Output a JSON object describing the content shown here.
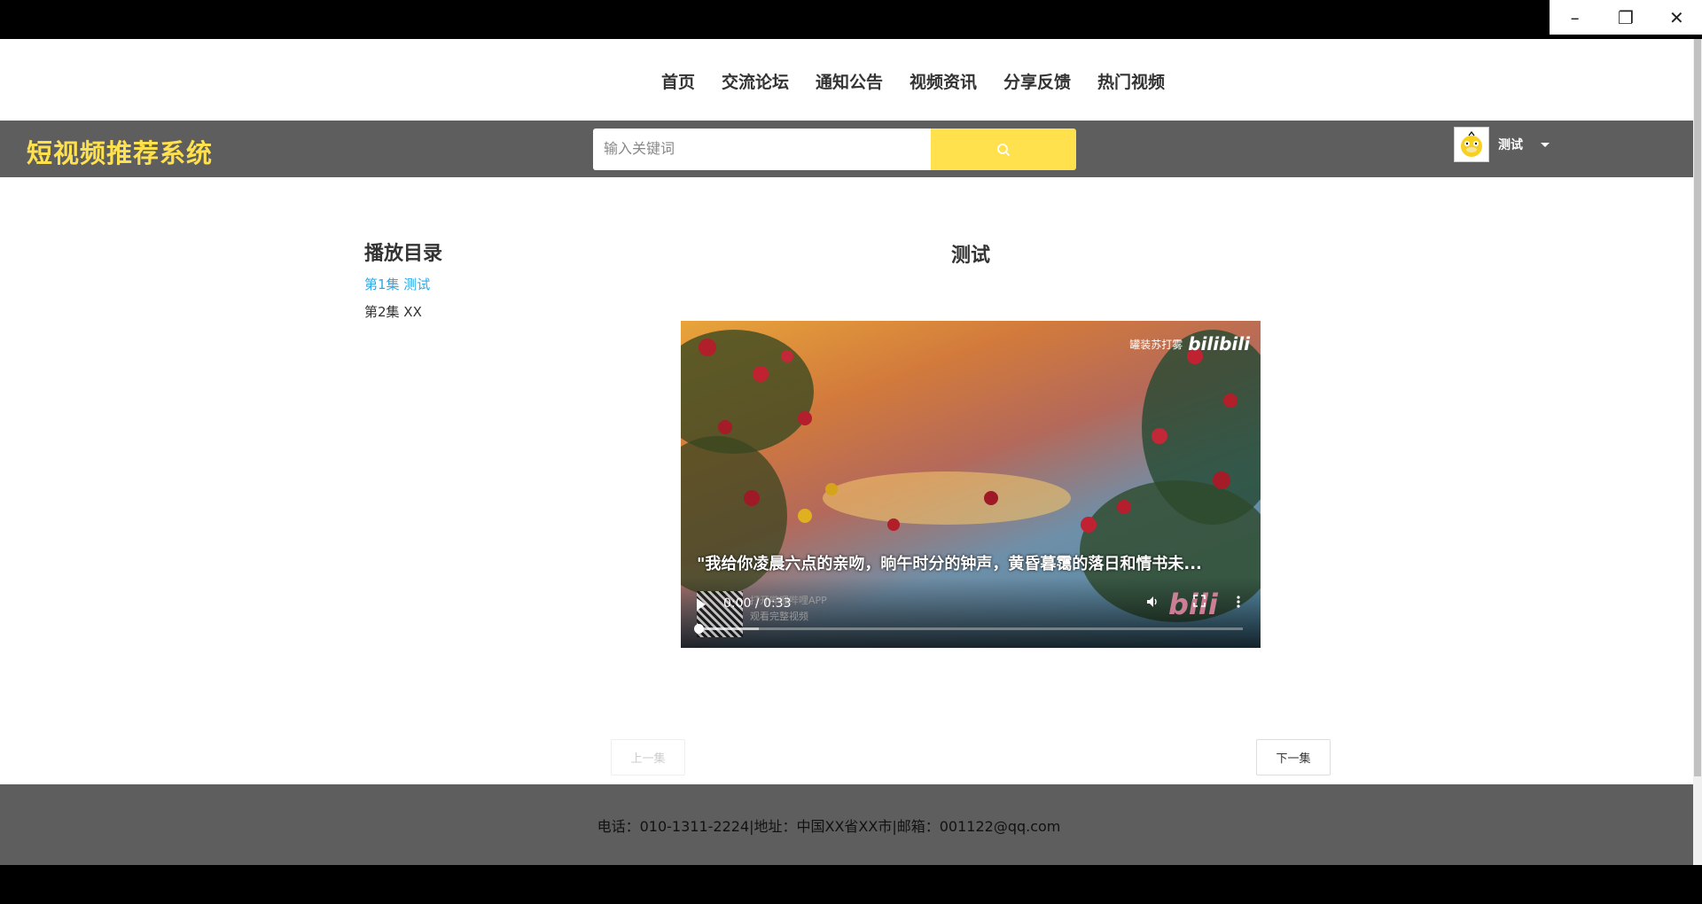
{
  "nav": {
    "items": [
      "首页",
      "交流论坛",
      "通知公告",
      "视频资讯",
      "分享反馈",
      "热门视频"
    ]
  },
  "header": {
    "brand": "短视频推荐系统",
    "search_placeholder": "输入关键词",
    "username": "测试"
  },
  "sidebar": {
    "title": "播放目录",
    "episodes": [
      "第1集 测试",
      "第2集 XX"
    ],
    "active_index": 0
  },
  "video": {
    "title": "测试",
    "watermark_text": "罐装苏打雾",
    "watermark_logo": "bilibili",
    "subtitle": "\"我给你凌晨六点的亲吻，晌午时分的钟声，黄昏暮霭的落日和情书未...",
    "qr_text_line1": "打开哔哩哔哩APP",
    "qr_text_line2": "观看完整视频",
    "time": "0:00 / 0:33",
    "progress_buffered": 0.11,
    "progress_played": 0.0
  },
  "pager": {
    "prev": "上一集",
    "next": "下一集"
  },
  "footer": {
    "text": "电话：010-1311-2224|地址：中国XX省XX市|邮箱：001122@qq.com"
  },
  "colors": {
    "accent_yellow": "#ffe14d",
    "header_gray": "#5e5e5e",
    "link_blue": "#2ea8e6"
  }
}
